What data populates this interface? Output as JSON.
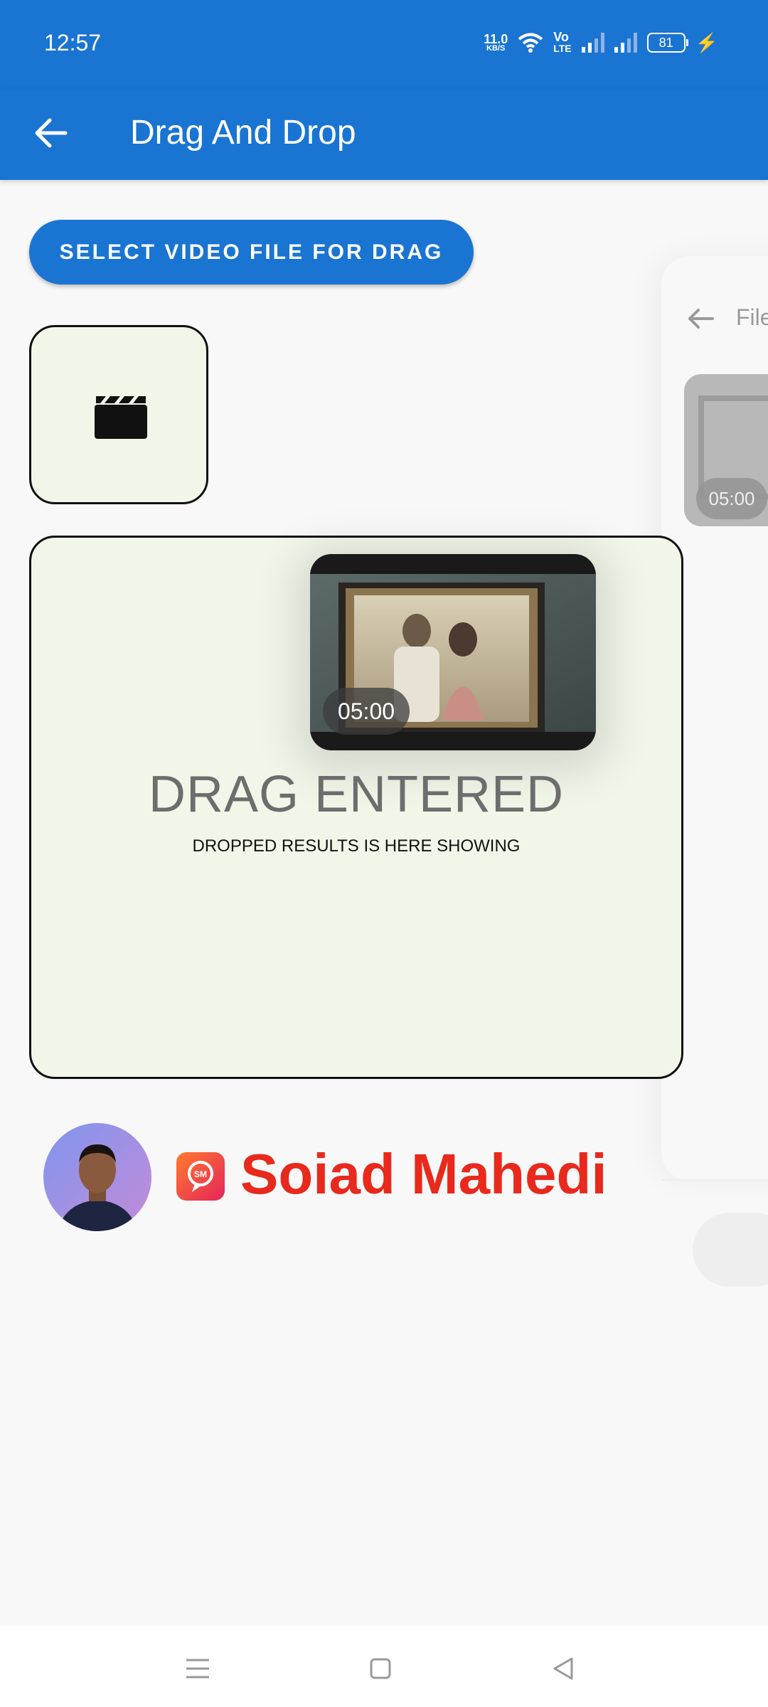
{
  "status_bar": {
    "time": "12:57",
    "speed_value": "11.0",
    "speed_unit": "KB/S",
    "volte_top": "Vo",
    "volte_bottom": "LTE",
    "battery": "81"
  },
  "app_bar": {
    "title": "Drag And Drop"
  },
  "select_button": {
    "label": "SELECT VIDEO FILE FOR DRAG"
  },
  "drop_zone": {
    "video_duration": "05:00",
    "status": "DRAG ENTERED",
    "subtitle": "DROPPED RESULTS IS HERE SHOWING"
  },
  "background_screen": {
    "title": "File",
    "video_duration": "05:00"
  },
  "branding": {
    "logo_text": "SM",
    "name": "Soiad Mahedi"
  },
  "colors": {
    "primary": "#1a74d2",
    "drop_zone_bg": "#f1f6e9",
    "brand_red": "#e8291c"
  }
}
